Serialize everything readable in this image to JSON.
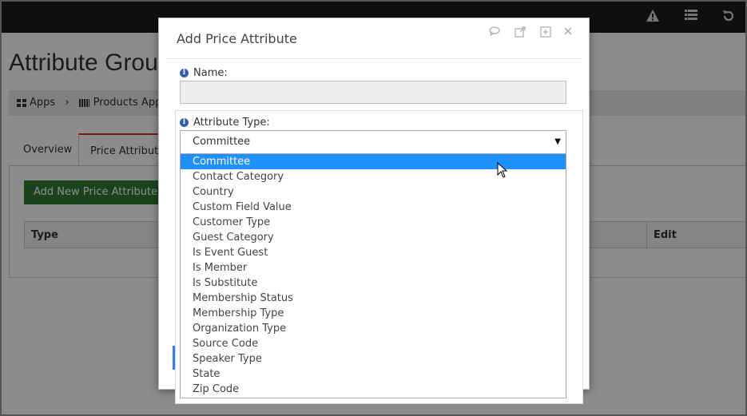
{
  "background": {
    "page_title": "Attribute Grou",
    "breadcrumb": {
      "apps": "Apps",
      "separator": "›",
      "products_app": "Products App"
    },
    "tabs": [
      {
        "label": "Overview"
      },
      {
        "label": "Price Attribute"
      }
    ],
    "add_button_label": "Add New Price Attribute ✚",
    "table_headers": {
      "type": "Type",
      "edit": "Edit"
    },
    "topbar_icons": [
      "warning-icon",
      "list-icon",
      "undo-icon"
    ]
  },
  "modal": {
    "title": "Add Price Attribute",
    "header_icons": [
      "comment-icon",
      "external-link-icon",
      "expand-icon",
      "close-icon"
    ],
    "name_label": "Name:",
    "name_value": "",
    "attribute_type_label": "Attribute Type:",
    "attribute_type_value": "Committee",
    "options": [
      "Committee",
      "Contact Category",
      "Country",
      "Custom Field Value",
      "Customer Type",
      "Guest Category",
      "Is Event Guest",
      "Is Member",
      "Is Substitute",
      "Membership Status",
      "Membership Type",
      "Organization Type",
      "Source Code",
      "Speaker Type",
      "State",
      "Zip Code"
    ],
    "highlighted_option": "Committee"
  },
  "colors": {
    "accent_blue": "#1e90ff",
    "add_button_green": "#2e7d32",
    "topbar": "#1c1c1c",
    "active_tab_border": "#c0392b"
  }
}
